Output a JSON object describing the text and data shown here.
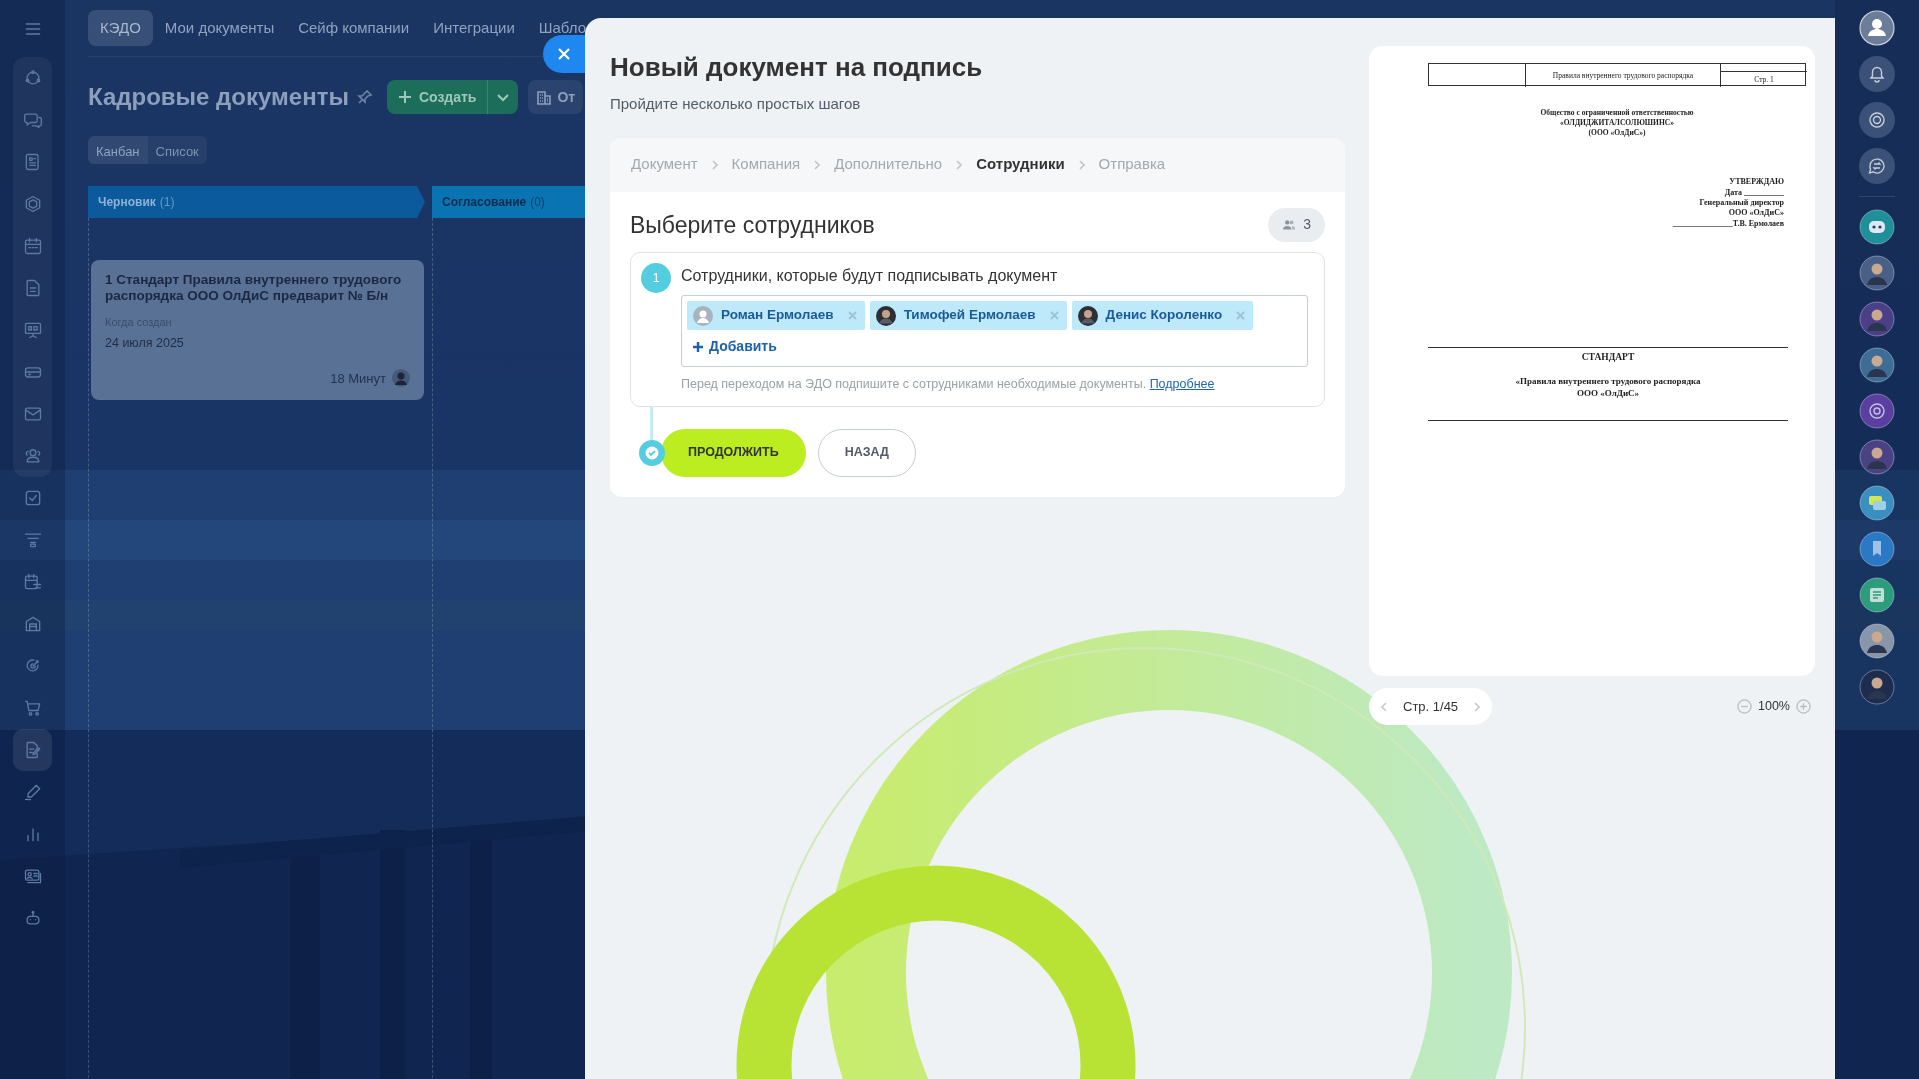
{
  "top_nav": {
    "tabs": [
      {
        "label": "КЭДО",
        "selected": true
      },
      {
        "label": "Мои документы",
        "selected": false
      },
      {
        "label": "Сейф компании",
        "selected": false
      },
      {
        "label": "Интеграции",
        "selected": false
      },
      {
        "label": "Шабло",
        "selected": false
      }
    ]
  },
  "sidebar": {
    "items": [
      {
        "selected": false
      },
      {
        "selected": false
      },
      {
        "selected": false
      },
      {
        "selected": false
      },
      {
        "selected": false
      },
      {
        "selected": false
      },
      {
        "selected": false
      },
      {
        "selected": false
      },
      {
        "selected": false
      },
      {
        "selected": false
      },
      {
        "selected": false
      },
      {
        "selected": false
      },
      {
        "selected": false
      },
      {
        "selected": false
      },
      {
        "selected": false
      },
      {
        "selected": false
      },
      {
        "selected": true
      },
      {
        "selected": false
      },
      {
        "selected": false
      },
      {
        "selected": false
      },
      {
        "selected": false
      }
    ]
  },
  "page": {
    "title": "Кадровые документы",
    "create_button": "Создать",
    "company_button": "От"
  },
  "view_switch": [
    {
      "label": "Канбан",
      "selected": true
    },
    {
      "label": "Список",
      "selected": false
    }
  ],
  "kanban": {
    "columns": [
      {
        "title": "Черновик",
        "count": "(1)",
        "color": "#0a5a9c",
        "cards": [
          {
            "title": "1 Стандарт Правила внутреннего трудового распорядка ООО ОлДиС предварит № Б/н",
            "date_label": "Когда создан",
            "date": "24 июля 2025",
            "age": "18 Минут"
          }
        ]
      },
      {
        "title": "Согласование",
        "count": "(0)",
        "color": "#0a74b3"
      }
    ]
  },
  "modal": {
    "title": "Новый документ на подпись",
    "subtitle": "Пройдите несколько простых шагов",
    "steps": [
      {
        "label": "Документ",
        "selected": false
      },
      {
        "label": "Компания",
        "selected": false
      },
      {
        "label": "Дополнительно",
        "selected": false
      },
      {
        "label": "Сотрудники",
        "selected": true
      },
      {
        "label": "Отправка",
        "selected": false
      }
    ],
    "section_title": "Выберите сотрудников",
    "employee_count": "3",
    "group": {
      "number": "1",
      "label": "Сотрудники, которые будут подписывать документ",
      "employees": [
        {
          "name": "Роман Ермолаев",
          "kind": "default"
        },
        {
          "name": "Тимофей Ермолаев"
        },
        {
          "name": "Денис Короленко"
        }
      ],
      "add_link": "Добавить",
      "hint": "Перед переходом на ЭДО подпишите с сотрудниками необходимые документы.",
      "hint_link": "Подробнее"
    },
    "buttons": {
      "continue": "ПРОДОЛЖИТЬ",
      "back": "НАЗАД"
    },
    "preview": {
      "header_title": "Правила внутреннего трудового распорядка",
      "header_page": "Стр. 1",
      "company": [
        "Общество с ограниченной ответственностью",
        "«ОЛДИДЖИТАЛСОЛЮШИНС»",
        "(ООО «ОлДиС»)"
      ],
      "approval": [
        "УТВЕРЖДАЮ",
        "Дата __________",
        "Генеральный директор",
        "ООО «ОлДиС»",
        "_______________Т.В. Ермолаев"
      ],
      "standard": "СТАНДАРТ",
      "doc_title": [
        "«Правила внутреннего трудового распорядка",
        "ООО «ОлДиС»"
      ],
      "pager": "Стр. 1/45",
      "zoom": "100%"
    }
  }
}
